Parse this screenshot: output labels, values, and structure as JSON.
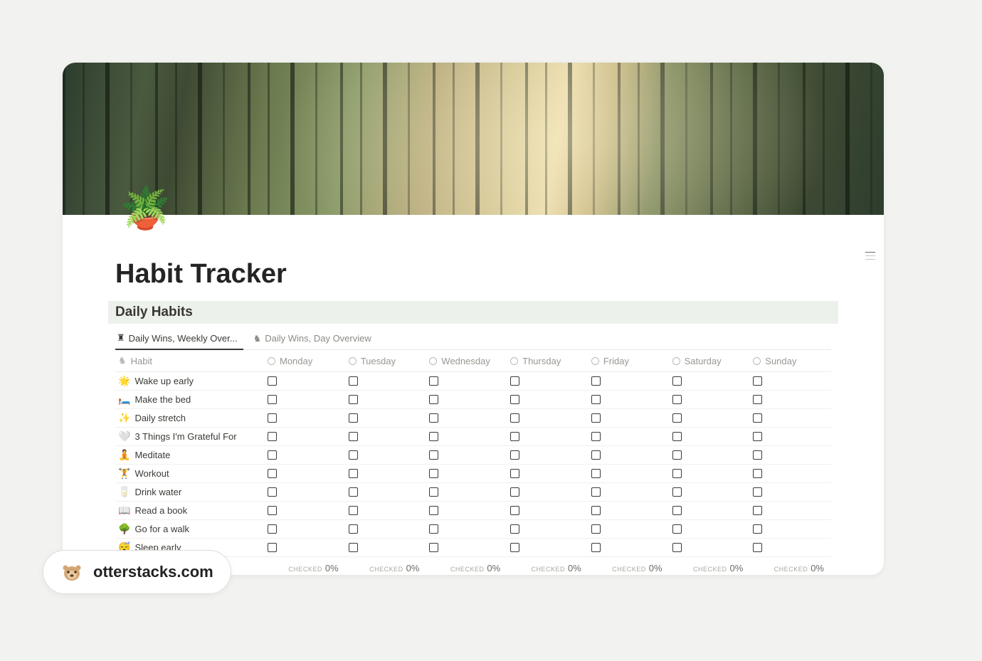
{
  "page": {
    "icon": "🪴",
    "title": "Habit Tracker",
    "section_title": "Daily Habits"
  },
  "tabs": [
    {
      "icon": "♜",
      "label": "Daily Wins, Weekly Over...",
      "active": true
    },
    {
      "icon": "♞",
      "label": "Daily Wins, Day Overview",
      "active": false
    }
  ],
  "columns": {
    "habit_label": "Habit",
    "days": [
      "Monday",
      "Tuesday",
      "Wednesday",
      "Thursday",
      "Friday",
      "Saturday",
      "Sunday"
    ]
  },
  "habits": [
    {
      "emoji": "🌟",
      "name": "Wake up early"
    },
    {
      "emoji": "🛏️",
      "name": "Make the bed"
    },
    {
      "emoji": "✨",
      "name": "Daily stretch"
    },
    {
      "emoji": "🤍",
      "name": "3 Things I'm Grateful For"
    },
    {
      "emoji": "🧘",
      "name": "Meditate"
    },
    {
      "emoji": "🏋️",
      "name": "Workout"
    },
    {
      "emoji": "🥛",
      "name": "Drink water"
    },
    {
      "emoji": "📖",
      "name": "Read a book"
    },
    {
      "emoji": "🌳",
      "name": "Go for a walk"
    },
    {
      "emoji": "😴",
      "name": "Sleep early"
    }
  ],
  "footer": {
    "label": "CHECKED",
    "values": [
      "0%",
      "0%",
      "0%",
      "0%",
      "0%",
      "0%",
      "0%"
    ]
  },
  "watermark": {
    "text": "otterstacks.com",
    "logo": "🦦"
  }
}
